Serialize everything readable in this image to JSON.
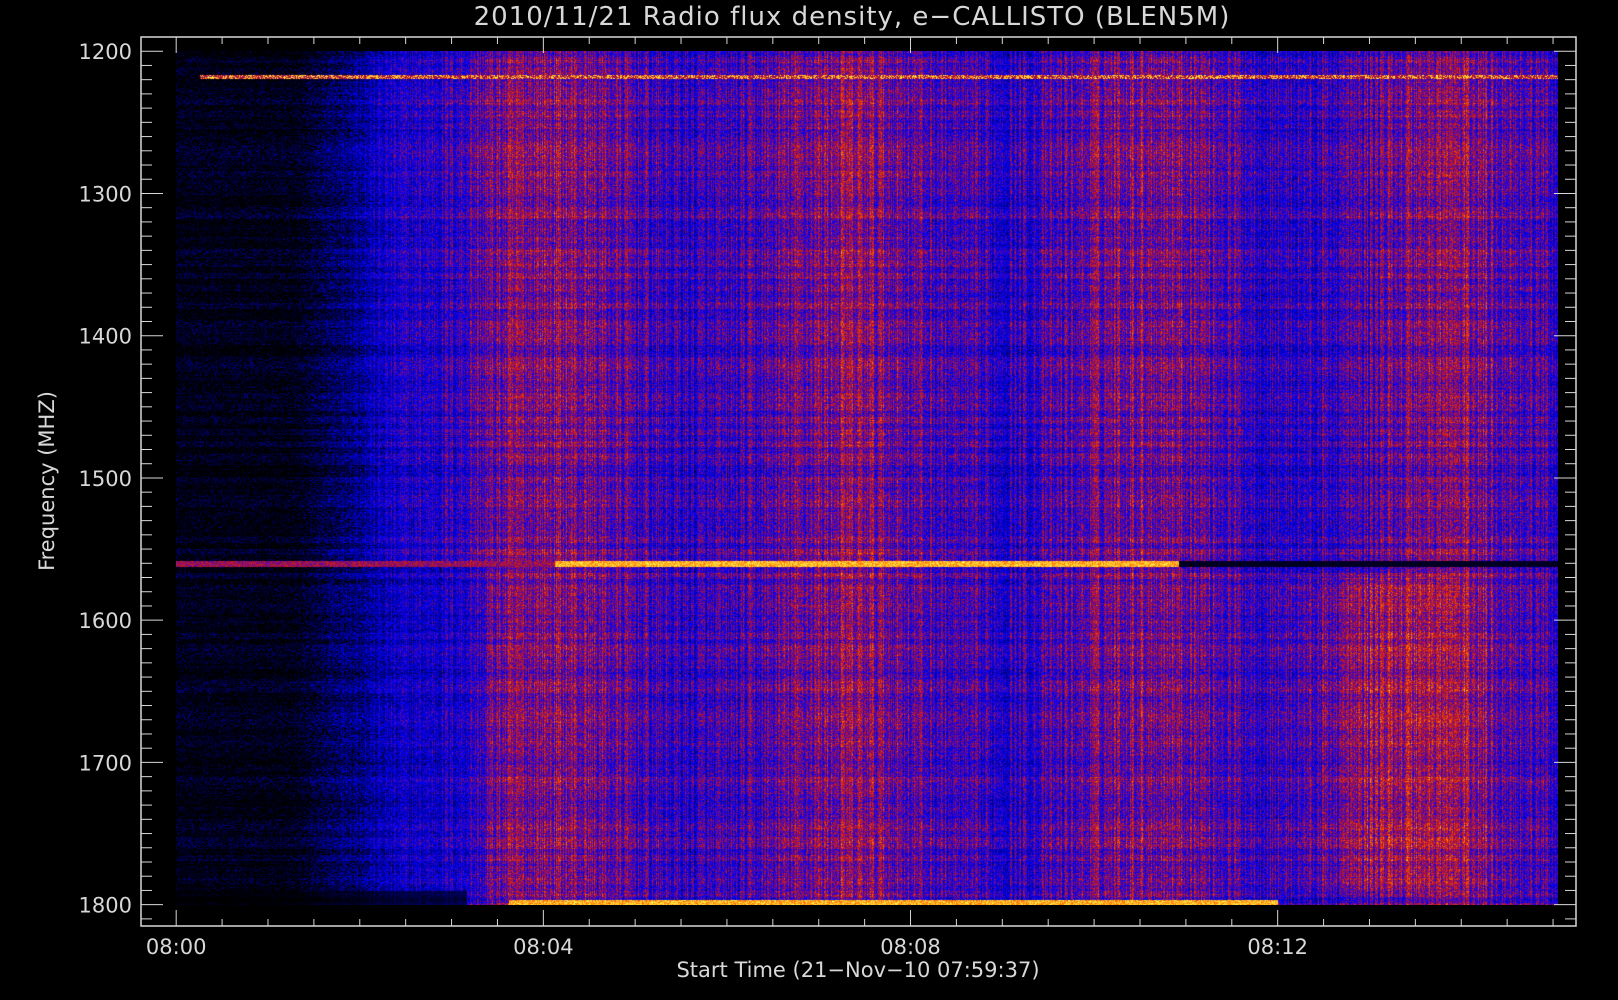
{
  "chart_data": {
    "type": "heatmap",
    "title": "2010/11/21  Radio flux density, e−CALLISTO (BLEN5M)",
    "xlabel": "Start Time (21−Nov−10 07:59:37)",
    "ylabel": "Frequency (MHZ)",
    "x_ticks": [
      "08:00",
      "08:04",
      "08:08",
      "08:12"
    ],
    "x_range": [
      "07:59:37",
      "08:15:15"
    ],
    "y_ticks": [
      "1200",
      "1300",
      "1400",
      "1500",
      "1600",
      "1700",
      "1800"
    ],
    "y_range": [
      1190,
      1815
    ],
    "y_reversed": true,
    "data_extent": {
      "time_start": "08:00:00",
      "time_end": "08:15:03",
      "freq_min": 1200,
      "freq_max": 1800
    },
    "colormap": [
      "#000000",
      "#0000ff",
      "#d01818",
      "#ff6a00",
      "#ffff50"
    ],
    "features": [
      {
        "name": "interference line",
        "freq": 1218,
        "time_start": "08:00:15",
        "time_end": "08:15:03"
      },
      {
        "name": "interference line",
        "freq": 1560,
        "time_start": "07:59:57",
        "time_end": "08:15:03"
      },
      {
        "name": "bright band",
        "freq": 1560,
        "time_start": "08:04:07",
        "time_end": "08:10:55"
      },
      {
        "name": "bright band",
        "freq": 1800,
        "time_start": "08:03:37",
        "time_end": "08:12:00"
      },
      {
        "name": "enhanced emission",
        "time_start": "08:11:30",
        "time_end": "08:14:30",
        "freq_min": 1570,
        "freq_max": 1790
      }
    ]
  }
}
